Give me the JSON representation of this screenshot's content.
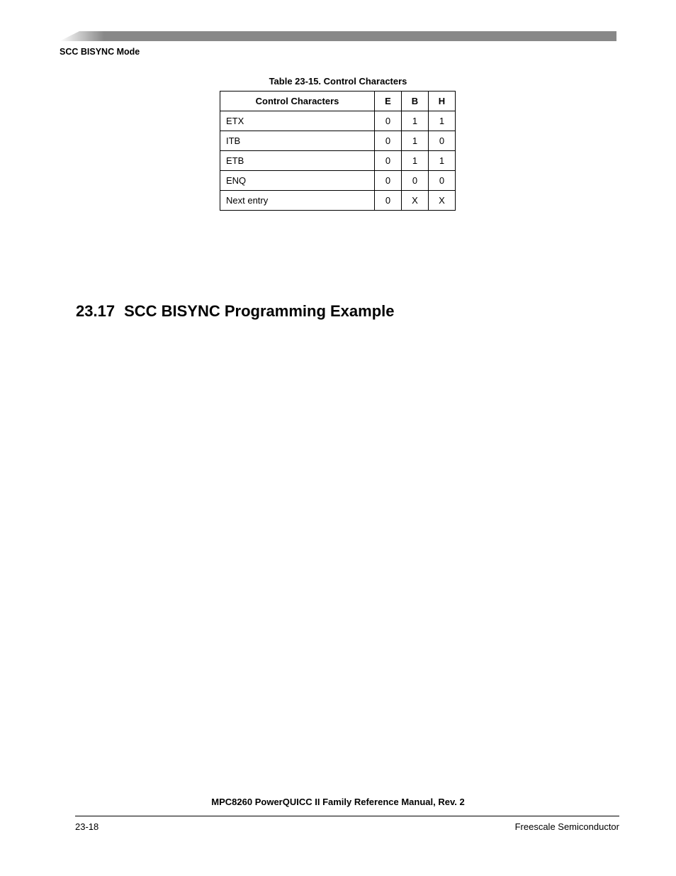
{
  "header": {
    "section_label": "SCC BISYNC Mode"
  },
  "table": {
    "caption": "Table 23-15. Control Characters",
    "columns": [
      "Control Characters",
      "E",
      "B",
      "H"
    ],
    "rows": [
      {
        "label": "ETX",
        "E": "0",
        "B": "1",
        "H": "1"
      },
      {
        "label": "ITB",
        "E": "0",
        "B": "1",
        "H": "0"
      },
      {
        "label": "ETB",
        "E": "0",
        "B": "1",
        "H": "1"
      },
      {
        "label": "ENQ",
        "E": "0",
        "B": "0",
        "H": "0"
      },
      {
        "label": "Next entry",
        "E": "0",
        "B": "X",
        "H": "X"
      }
    ]
  },
  "section": {
    "number": "23.17",
    "title": "SCC BISYNC Programming Example"
  },
  "footer": {
    "manual_title": "MPC8260 PowerQUICC II Family Reference Manual, Rev. 2",
    "page_number": "23-18",
    "company": "Freescale Semiconductor"
  }
}
